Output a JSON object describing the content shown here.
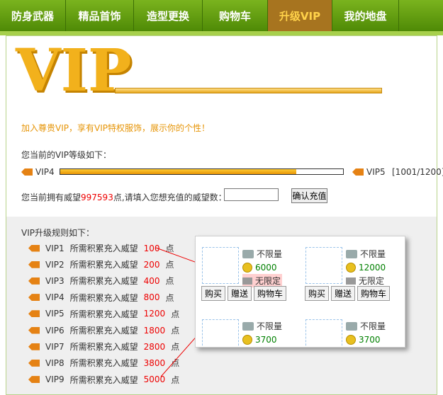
{
  "nav": [
    "防身武器",
    "精品首饰",
    "造型更换",
    "购物车",
    "升级VIP",
    "我的地盘"
  ],
  "logo": "VIP",
  "intro": "加入尊贵VIP，享有VIP特权服饰，展示你的个性！",
  "level_title": "您当前的VIP等级如下：",
  "current_vip": "VIP4",
  "next_vip": "VIP5",
  "progress_text": "[1001/1200]",
  "progress_fraction": 0.834,
  "reputation_prefix": "您当前拥有威望",
  "reputation_value": "997593",
  "reputation_suffix": "点,请填入您想充值的威望数：",
  "confirm_button": "确认充值",
  "rule_title": "VIP升级规则如下：",
  "rules": [
    {
      "level": "VIP1",
      "text": "所需积累充入威望",
      "amount": "100",
      "unit": "点"
    },
    {
      "level": "VIP2",
      "text": "所需积累充入威望",
      "amount": "200",
      "unit": "点"
    },
    {
      "level": "VIP3",
      "text": "所需积累充入威望",
      "amount": "400",
      "unit": "点"
    },
    {
      "level": "VIP4",
      "text": "所需积累充入威望",
      "amount": "800",
      "unit": "点"
    },
    {
      "level": "VIP5",
      "text": "所需积累充入威望",
      "amount": "1200",
      "unit": "点"
    },
    {
      "level": "VIP6",
      "text": "所需积累充入威望",
      "amount": "1800",
      "unit": "点"
    },
    {
      "level": "VIP7",
      "text": "所需积累充入威望",
      "amount": "2800",
      "unit": "点"
    },
    {
      "level": "VIP8",
      "text": "所需积累充入威望",
      "amount": "3800",
      "unit": "点"
    },
    {
      "level": "VIP9",
      "text": "所需积累充入威望",
      "amount": "5000",
      "unit": "点"
    }
  ],
  "shop": {
    "cards": [
      {
        "limit": "不限量",
        "price": "6000",
        "restriction": "无限定",
        "buttons": [
          "购买",
          "赠送",
          "购物车"
        ]
      },
      {
        "limit": "不限量",
        "price": "12000",
        "restriction": "无限定",
        "buttons": [
          "购买",
          "赠送",
          "购物车"
        ]
      },
      {
        "limit": "不限量",
        "price": "3700"
      },
      {
        "limit": "不限量",
        "price": "3700"
      }
    ]
  }
}
